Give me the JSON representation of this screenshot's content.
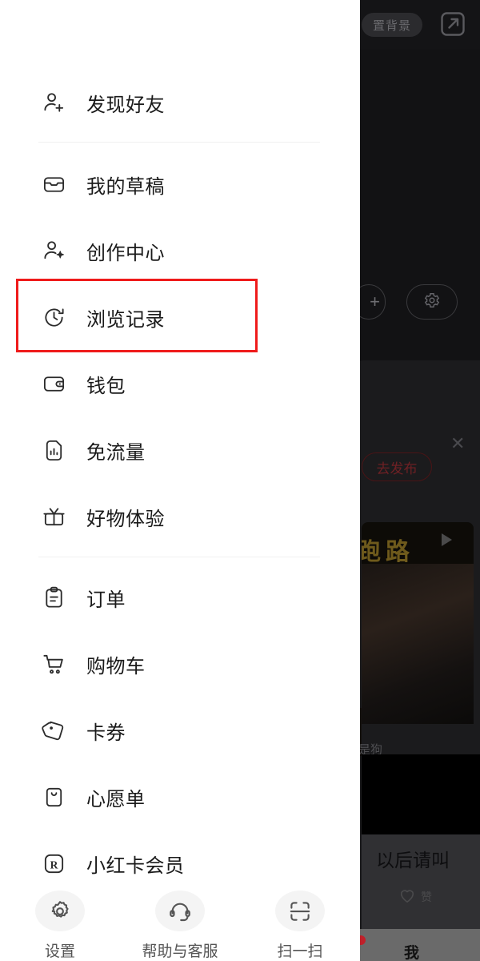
{
  "panel": {
    "menu_items": [
      {
        "label": "发现好友",
        "icon": "person-add-icon"
      },
      {
        "label": "我的草稿",
        "icon": "draft-tray-icon"
      },
      {
        "label": "创作中心",
        "icon": "person-sparkle-icon"
      },
      {
        "label": "浏览记录",
        "icon": "history-clock-icon"
      },
      {
        "label": "钱包",
        "icon": "wallet-icon"
      },
      {
        "label": "免流量",
        "icon": "data-free-icon"
      },
      {
        "label": "好物体验",
        "icon": "gift-icon"
      },
      {
        "label": "订单",
        "icon": "clipboard-order-icon"
      },
      {
        "label": "购物车",
        "icon": "shopping-cart-icon"
      },
      {
        "label": "卡券",
        "icon": "coupon-tag-icon"
      },
      {
        "label": "心愿单",
        "icon": "wishlist-bag-icon"
      },
      {
        "label": "小红卡会员",
        "icon": "r-card-member-icon"
      }
    ],
    "highlighted_item": "浏览记录",
    "highlight_color": "#ef1b1b",
    "actions": [
      {
        "label": "设置",
        "icon": "gear-icon"
      },
      {
        "label": "帮助与客服",
        "icon": "headset-icon"
      },
      {
        "label": "扫一扫",
        "icon": "scan-icon"
      }
    ]
  },
  "background": {
    "set_background_label": "置背景",
    "share_icon": "external-link-icon",
    "add_label": "+",
    "settings_icon": "gear-icon",
    "publish_label": "去发布",
    "close_icon": "close-icon",
    "video_title": "跑路",
    "play_icon": "play-icon",
    "photo_caption": "是狗",
    "post_text": "以后请叫",
    "like_label": "赞",
    "like_icon": "heart-icon",
    "tab_me_label": "我"
  }
}
